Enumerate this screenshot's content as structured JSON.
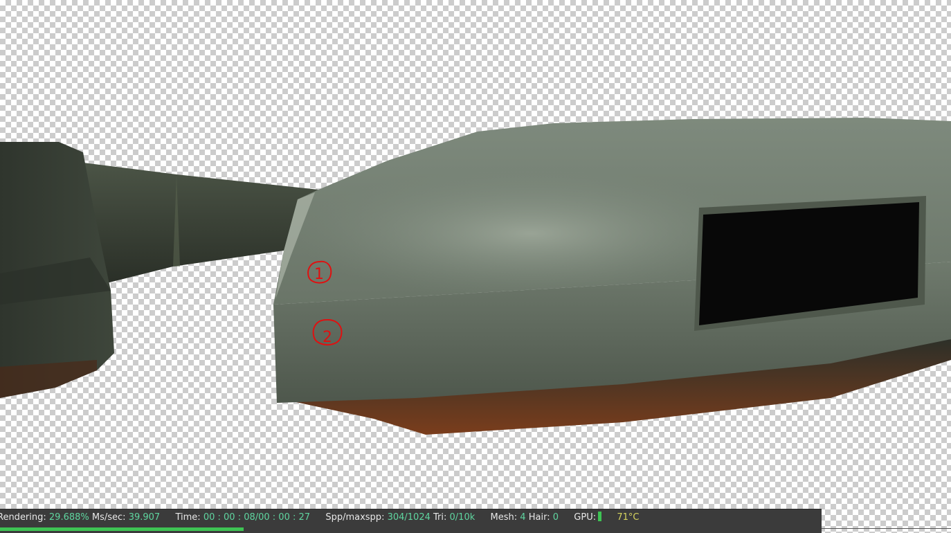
{
  "viewport": {
    "annotations": [
      "1",
      "2"
    ],
    "annotation_color": "#e01010",
    "object_color": "#6d7a6c",
    "object_dark_color": "#3a4238",
    "underside_color": "#7a3d1c",
    "window_color": "#080808"
  },
  "status_bar": {
    "rendering_label": "Rendering:",
    "rendering_value": "29.688%",
    "ms_label": "Ms/sec:",
    "ms_value": "39.907",
    "time_label": "Time:",
    "time_value": "00 : 00 : 08/00 : 00 : 27",
    "spp_label": "Spp/maxspp:",
    "spp_value": "304/1024",
    "tri_label": "Tri:",
    "tri_value": "0/10k",
    "mesh_label": "Mesh:",
    "mesh_value": "4",
    "hair_label": "Hair:",
    "hair_value": "0",
    "gpu_label": "GPU:",
    "gpu_temp": "71°C",
    "progress_fraction": 0.29688,
    "progress_color": "#3ec454",
    "value_color": "#5fd6a0",
    "temp_color": "#d6d45f"
  }
}
